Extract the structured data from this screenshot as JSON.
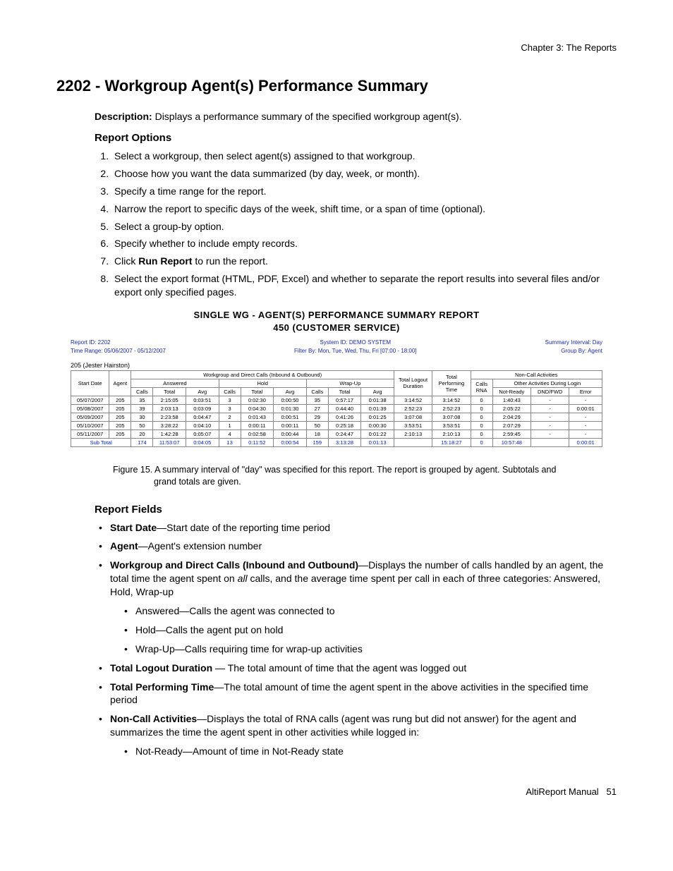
{
  "chapter": "Chapter 3:  The Reports",
  "title": "2202 - Workgroup Agent(s) Performance Summary",
  "description_label": "Description:",
  "description_text": " Displays a performance summary of the specified workgroup agent(s).",
  "report_options_heading": "Report Options",
  "options": [
    "Select a workgroup, then select agent(s) assigned to that workgroup.",
    "Choose how you want the data summarized (by day, week, or month).",
    "Specify a time range for the report.",
    "Narrow the report to specific days of the week, shift time, or a span of time (optional).",
    "Select a group-by option.",
    "Specify whether to include empty records.",
    "",
    "Select the export format (HTML, PDF, Excel) and whether to separate the report results into several files and/or export only specified pages."
  ],
  "opt7_pre": "Click ",
  "opt7_bold": "Run Report",
  "opt7_post": " to run the report.",
  "report": {
    "title1": "SINGLE WG - AGENT(S) PERFORMANCE SUMMARY REPORT",
    "title2": "450 (CUSTOMER SERVICE)",
    "meta_left1": "Report ID: 2202",
    "meta_left2": "Time Range: 05/06/2007 - 05/12/2007",
    "meta_mid1": "System ID: DEMO SYSTEM",
    "meta_mid2": "Filter By: Mon, Tue, Wed, Thu, Fri [07:00 - 18:00]",
    "meta_right1": "Summary Interval: Day",
    "meta_right2": "Group By: Agent",
    "agent_label": "205 (Jester Hairston)",
    "group_head": "Workgroup and Direct Calls (Inbound & Outbound)",
    "noncall_head": "Non-Call Activities",
    "col_start": "Start Date",
    "col_agent": "Agent",
    "col_answered": "Answered",
    "col_hold": "Hold",
    "col_wrapup": "Wrap-Up",
    "col_logout": "Total Logout Duration",
    "col_perf": "Total Performing Time",
    "col_calls_rna": "Calls RNA",
    "col_other": "Other Activities During Login",
    "sub_calls": "Calls",
    "sub_total": "Total",
    "sub_avg": "Avg",
    "sub_notready": "Not-Ready",
    "sub_dnd": "DND/FWD",
    "sub_error": "Error",
    "rows": [
      [
        "05/07/2007",
        "205",
        "35",
        "2:15:05",
        "0:03:51",
        "3",
        "0:02:30",
        "0:00:50",
        "35",
        "0:57:17",
        "0:01:38",
        "3:14:52",
        "3:14:52",
        "0",
        "1:40:43",
        "-",
        "-"
      ],
      [
        "05/08/2007",
        "205",
        "39",
        "2:03:13",
        "0:03:09",
        "3",
        "0:04:30",
        "0:01:30",
        "27",
        "0:44:40",
        "0:01:39",
        "2:52:23",
        "2:52:23",
        "0",
        "2:05:22",
        "-",
        "0:00:01"
      ],
      [
        "05/09/2007",
        "205",
        "30",
        "2:23:58",
        "0:04:47",
        "2",
        "0:01:43",
        "0:00:51",
        "29",
        "0:41:26",
        "0:01:25",
        "3:07:08",
        "3:07:08",
        "0",
        "2:04:29",
        "-",
        "-"
      ],
      [
        "05/10/2007",
        "205",
        "50",
        "3:28:22",
        "0:04:10",
        "1",
        "0:00:11",
        "0:00:11",
        "50",
        "0:25:18",
        "0:00:30",
        "3:53:51",
        "3:53:51",
        "0",
        "2:07:29",
        "-",
        "-"
      ],
      [
        "05/11/2007",
        "205",
        "20",
        "1:42:28",
        "0:05:07",
        "4",
        "0:02:58",
        "0:00:44",
        "18",
        "0:24:47",
        "0:01:22",
        "2:10:13",
        "2:10:13",
        "0",
        "2:59:45",
        "-",
        "-"
      ]
    ],
    "subtotal_label": "Sub Total",
    "subtotal": [
      "174",
      "11:53:07",
      "0:04:05",
      "13",
      "0:11:52",
      "0:00:54",
      "159",
      "3:13:28",
      "0:01:13",
      "",
      "15:18:27",
      "0",
      "10:57:48",
      "",
      "0:00:01"
    ]
  },
  "caption": "Figure 15.   A summary interval of \"day\" was specified for this report. The report is grouped by agent. Subtotals and grand totals are given.",
  "report_fields_heading": "Report Fields",
  "fields": {
    "f1b": "Start Date",
    "f1t": "—Start date of the reporting time period",
    "f2b": "Agent",
    "f2t": "—Agent's extension number",
    "f3b": "Workgroup and Direct Calls (Inbound and Outbound)",
    "f3t_pre": "—Displays the number of calls handled by an agent, the total time the agent spent on ",
    "f3t_em": "all",
    "f3t_post": " calls, and the average time spent per call in each of three categories: Answered, Hold, Wrap-up",
    "f3s1": "Answered—Calls the agent was connected to",
    "f3s2": "Hold—Calls the agent put on hold",
    "f3s3": "Wrap-Up—Calls requiring time for wrap-up activities",
    "f4b": "Total Logout Duration",
    "f4t": " — The total amount of time that the agent was logged out",
    "f5b": "Total Performing Time",
    "f5t": "—The total amount of time the agent spent in the above activities in the specified time period",
    "f6b": "Non-Call Activities",
    "f6t": "—Displays the total of RNA calls (agent was rung but did not answer) for the agent and summarizes the time the agent spent in other activities while logged in:",
    "f6s1": "Not-Ready—Amount of time in Not-Ready state"
  },
  "footer_text": "AltiReport Manual",
  "footer_page": "51"
}
